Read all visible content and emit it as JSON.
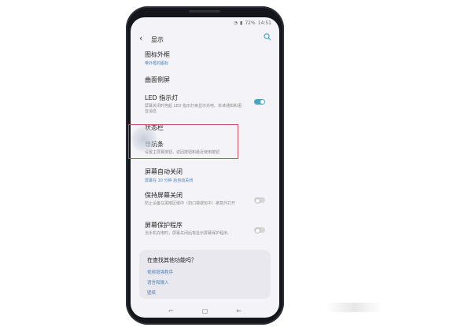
{
  "statusbar": {
    "battery": "72%",
    "time": "14:51"
  },
  "header": {
    "back": "‹",
    "title": "显示"
  },
  "items": {
    "icon_frame": {
      "title": "图标外框",
      "sub": "带外框的图标"
    },
    "edge_screen": {
      "title": "曲面侧屏"
    },
    "led": {
      "title": "LED 指示灯",
      "desc": "屏幕关闭时亮起 LED 指示灯来显示充电、未读通知和语音消息",
      "toggle": "on"
    },
    "status_bar": {
      "title": "状态栏"
    },
    "nav_bar": {
      "title": "导航条",
      "desc": "设置主屏幕按钮、返回按钮和最近使用按钮"
    },
    "screen_timeout": {
      "title": "屏幕自动关闭",
      "sub": "屏幕在 10 分钟 后自动关闭"
    },
    "keep_screen_off": {
      "title": "保持屏幕关闭",
      "desc": "防止设备在黑暗区域中（如口袋或包中）被意外打开",
      "toggle": "off"
    },
    "screensaver": {
      "title": "屏幕保护程序",
      "desc": "当手机充电时，屏幕关闭后将显示屏幕保护程序。",
      "toggle": "off"
    }
  },
  "card": {
    "heading": "在查找其他功能吗？",
    "links": [
      "视频增强程序",
      "语言和输入",
      "壁纸"
    ]
  },
  "navbar": {
    "recent": "⌐",
    "home": "▢",
    "back": "←"
  },
  "colors": {
    "accent": "#4aa3c4",
    "highlight": "#c9525e",
    "link": "#4b7fb8"
  }
}
